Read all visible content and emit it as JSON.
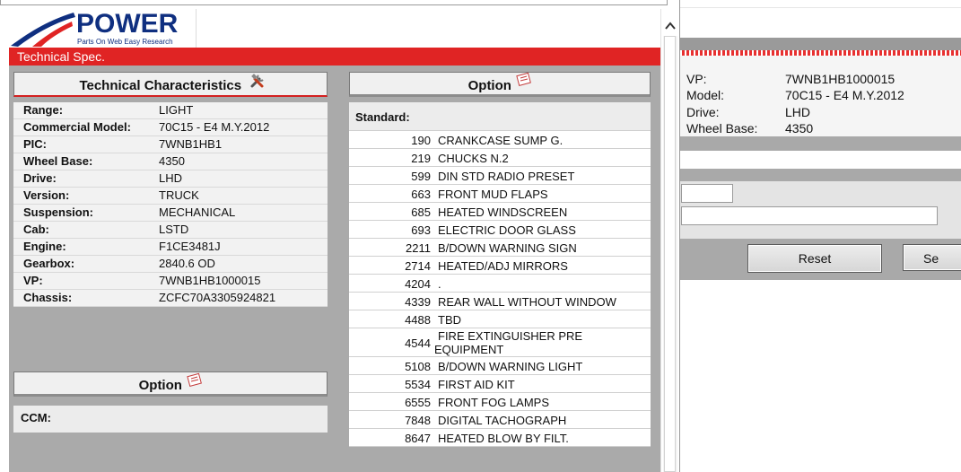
{
  "background_window": {
    "info": [
      {
        "label": "VP:",
        "value": "7WNB1HB1000015"
      },
      {
        "label": "Model:",
        "value": "70C15 - E4 M.Y.2012"
      },
      {
        "label": "Drive:",
        "value": "LHD"
      },
      {
        "label": "Wheel Base:",
        "value": "4350"
      }
    ],
    "buttons": {
      "reset": "Reset",
      "partial": "Se"
    }
  },
  "logo": {
    "word": "POWER",
    "tagline": "Parts On Web Easy Research"
  },
  "header": {
    "title": "Technical Spec."
  },
  "tech": {
    "title": "Technical Characteristics",
    "icon": "tools-icon",
    "rows": [
      {
        "label": "Range:",
        "value": "LIGHT"
      },
      {
        "label": "Commercial Model:",
        "value": "70C15 - E4 M.Y.2012"
      },
      {
        "label": "PIC:",
        "value": "7WNB1HB1"
      },
      {
        "label": "Wheel Base:",
        "value": "4350"
      },
      {
        "label": "Drive:",
        "value": "LHD"
      },
      {
        "label": "Version:",
        "value": "TRUCK"
      },
      {
        "label": "Suspension:",
        "value": "MECHANICAL"
      },
      {
        "label": "Cab:",
        "value": "LSTD"
      },
      {
        "label": "Engine:",
        "value": "F1CE3481J"
      },
      {
        "label": "Gearbox:",
        "value": "2840.6 OD"
      },
      {
        "label": "VP:",
        "value": "7WNB1HB1000015"
      },
      {
        "label": "Chassis:",
        "value": "ZCFC70A3305924821"
      }
    ]
  },
  "option_left": {
    "title": "Option",
    "icon": "notepad-icon",
    "ccm_label": "CCM:"
  },
  "option_right": {
    "title": "Option",
    "icon": "notepad-icon",
    "standard_label": "Standard:",
    "rows": [
      {
        "code": "190",
        "desc": "CRANKCASE SUMP G."
      },
      {
        "code": "219",
        "desc": "CHUCKS N.2"
      },
      {
        "code": "599",
        "desc": "DIN STD RADIO PRESET"
      },
      {
        "code": "663",
        "desc": "FRONT MUD FLAPS"
      },
      {
        "code": "685",
        "desc": "HEATED WINDSCREEN"
      },
      {
        "code": "693",
        "desc": "ELECTRIC DOOR GLASS"
      },
      {
        "code": "2211",
        "desc": "B/DOWN WARNING SIGN"
      },
      {
        "code": "2714",
        "desc": "HEATED/ADJ MIRRORS"
      },
      {
        "code": "4204",
        "desc": "."
      },
      {
        "code": "4339",
        "desc": "REAR WALL WITHOUT WINDOW"
      },
      {
        "code": "4488",
        "desc": "TBD"
      },
      {
        "code": "4544",
        "desc": "FIRE EXTINGUISHER PRE EQUIPMENT"
      },
      {
        "code": "5108",
        "desc": "B/DOWN WARNING LIGHT"
      },
      {
        "code": "5534",
        "desc": "FIRST AID KIT"
      },
      {
        "code": "6555",
        "desc": "FRONT FOG LAMPS"
      },
      {
        "code": "7848",
        "desc": "DIGITAL TACHOGRAPH"
      },
      {
        "code": "8647",
        "desc": "HEATED BLOW BY FILT."
      }
    ]
  },
  "colors": {
    "brand_red": "#e02424",
    "brand_blue": "#0f2f80",
    "panel_gray": "#aaaaaa"
  }
}
